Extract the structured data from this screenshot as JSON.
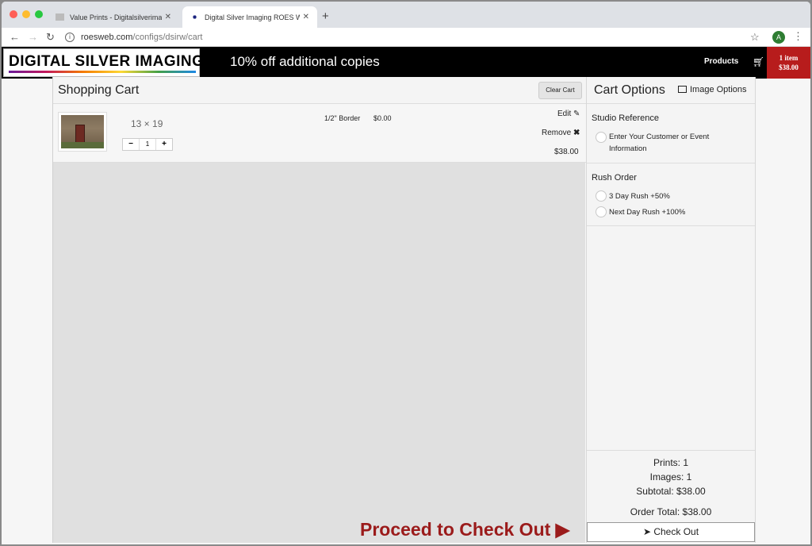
{
  "browser": {
    "tabs": [
      {
        "title": "Value Prints - Digitalsilverimag"
      },
      {
        "title": "Digital Silver Imaging ROES We"
      }
    ],
    "url_host": "roesweb.com",
    "url_path": "/configs/dsirw/cart",
    "profile_initial": "A"
  },
  "header": {
    "logo_text": "DIGITAL SILVER IMAGING",
    "promo": "10% off additional copies",
    "products_label": "Products",
    "cart_count": "1 item",
    "cart_total": "$38.00"
  },
  "cart": {
    "title": "Shopping Cart",
    "clear_label": "Clear Cart",
    "item": {
      "size": "13 × 19",
      "quantity": "1",
      "option": "1/2\" Border",
      "option_price": "$0.00",
      "edit_label": "Edit",
      "remove_label": "Remove",
      "price": "$38.00"
    },
    "proceed_label": "Proceed to Check Out"
  },
  "options": {
    "title": "Cart Options",
    "image_options_label": "Image Options",
    "studio": {
      "title": "Studio Reference",
      "option": "Enter Your Customer or Event Information"
    },
    "rush": {
      "title": "Rush Order",
      "option1": "3 Day Rush +50%",
      "option2": "Next Day Rush +100%"
    },
    "summary": {
      "prints": "Prints: 1",
      "images": "Images: 1",
      "subtotal": "Subtotal: $38.00",
      "order_total": "Order Total: $38.00"
    },
    "checkout_label": "Check Out"
  },
  "colors": {
    "brand_red": "#9b1b1b",
    "cart_badge": "#b71c1c",
    "header_bg": "#000000"
  }
}
